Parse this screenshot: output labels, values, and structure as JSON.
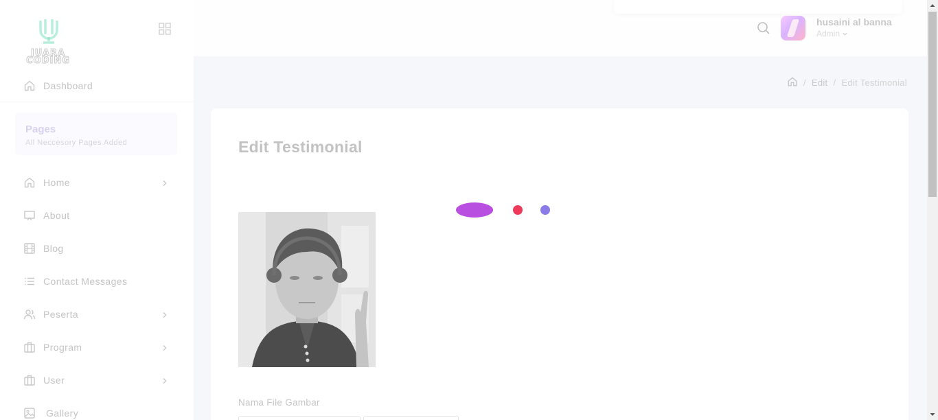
{
  "brand": {
    "logo_line1": "JUARA",
    "logo_line2": "CODING"
  },
  "sidebar": {
    "dashboard": {
      "label": "Dashboard",
      "icon": "home-icon"
    },
    "pages_section": {
      "title": "Pages",
      "subtitle": "All Neccesory Pages Added"
    },
    "items": [
      {
        "label": "Home",
        "icon": "home-icon",
        "has_submenu": true
      },
      {
        "label": "About",
        "icon": "monitor-icon",
        "has_submenu": false
      },
      {
        "label": "Blog",
        "icon": "film-icon",
        "has_submenu": false
      },
      {
        "label": "Contact Messages",
        "icon": "list-icon",
        "has_submenu": false
      },
      {
        "label": "Peserta",
        "icon": "users-icon",
        "has_submenu": true
      },
      {
        "label": "Program",
        "icon": "briefcase-icon",
        "has_submenu": true
      },
      {
        "label": "User",
        "icon": "briefcase-icon",
        "has_submenu": true
      },
      {
        "label": "Gallery",
        "icon": "image-icon",
        "has_submenu": false
      }
    ]
  },
  "header": {
    "user": {
      "name": "husaini al banna",
      "role": "Admin"
    }
  },
  "breadcrumb": {
    "items": [
      "Edit",
      "Edit Testimonial"
    ]
  },
  "main": {
    "title": "Edit Testimonial",
    "file_label": "Nama File Gambar"
  },
  "colors": {
    "loader_purple": "#b84fe0",
    "loader_red": "#ee3a5a",
    "loader_blue": "#8a7be8",
    "logo_accent": "#38d0a0"
  }
}
